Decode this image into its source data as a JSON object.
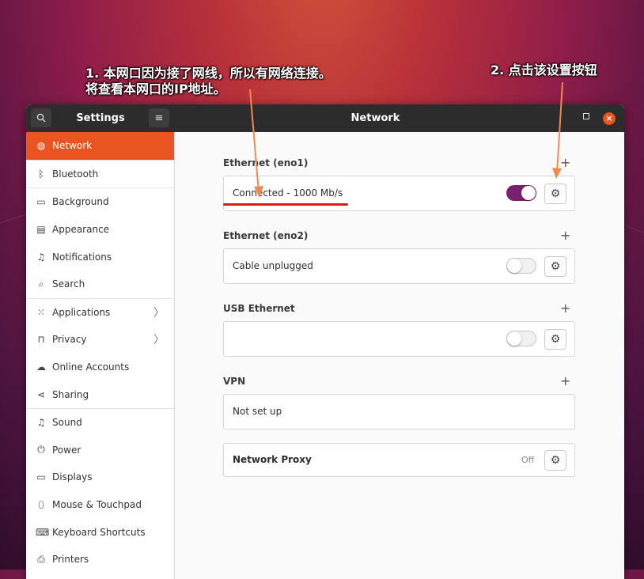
{
  "annotations": {
    "note1_line1": "1. 本网口因为接了网线，所以有网络连接。",
    "note1_line2": "将查看本网口的IP地址。",
    "note2": "2. 点击该设置按钮"
  },
  "titlebar": {
    "left_title": "Settings",
    "main_title": "Network"
  },
  "sidebar": {
    "items": [
      {
        "label": "Network",
        "icon": "network-icon"
      },
      {
        "label": "Bluetooth",
        "icon": "bluetooth-icon"
      },
      {
        "label": "Background",
        "icon": "background-icon"
      },
      {
        "label": "Appearance",
        "icon": "appearance-icon"
      },
      {
        "label": "Notifications",
        "icon": "bell-icon"
      },
      {
        "label": "Search",
        "icon": "search-icon"
      },
      {
        "label": "Applications",
        "icon": "apps-grid-icon"
      },
      {
        "label": "Privacy",
        "icon": "lock-icon"
      },
      {
        "label": "Online Accounts",
        "icon": "cloud-icon"
      },
      {
        "label": "Sharing",
        "icon": "share-icon"
      },
      {
        "label": "Sound",
        "icon": "music-note-icon"
      },
      {
        "label": "Power",
        "icon": "power-icon"
      },
      {
        "label": "Displays",
        "icon": "display-icon"
      },
      {
        "label": "Mouse & Touchpad",
        "icon": "mouse-icon"
      },
      {
        "label": "Keyboard Shortcuts",
        "icon": "keyboard-icon"
      },
      {
        "label": "Printers",
        "icon": "printer-icon"
      }
    ]
  },
  "sections": {
    "eno1": {
      "title": "Ethernet (eno1)",
      "status": "Connected - 1000 Mb/s",
      "enabled": true
    },
    "eno2": {
      "title": "Ethernet (eno2)",
      "status": "Cable unplugged",
      "enabled": false
    },
    "usb": {
      "title": "USB Ethernet",
      "status": "",
      "enabled": false
    },
    "vpn": {
      "title": "VPN",
      "status": "Not set up"
    },
    "proxy": {
      "label": "Network Proxy",
      "state": "Off"
    }
  },
  "colors": {
    "accent": "#e95420",
    "toggle_on": "#77216f",
    "annotation_arrow": "#f08a50",
    "underline": "#e0161f"
  }
}
